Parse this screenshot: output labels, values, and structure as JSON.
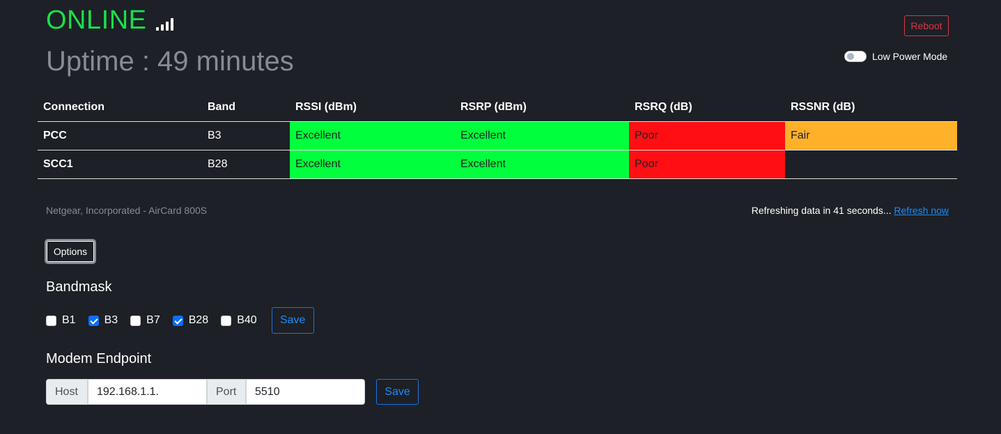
{
  "status": {
    "text": "ONLINE",
    "signal_bars": 4,
    "color": "#19e04a"
  },
  "uptime": "Uptime : 49 minutes",
  "header": {
    "reboot_label": "Reboot",
    "low_power_label": "Low Power Mode",
    "low_power_on": false
  },
  "table": {
    "headers": [
      "Connection",
      "Band",
      "RSSI (dBm)",
      "RSRP (dBm)",
      "RSRQ (dB)",
      "RSSNR (dB)"
    ],
    "rows": [
      {
        "connection": "PCC",
        "band": "B3",
        "rssi": "Excellent",
        "rsrp": "Excellent",
        "rsrq": "Poor",
        "rssnr": "Fair"
      },
      {
        "connection": "SCC1",
        "band": "B28",
        "rssi": "Excellent",
        "rsrp": "Excellent",
        "rsrq": "Poor",
        "rssnr": ""
      }
    ],
    "colors": {
      "excellent": "#00ff3c",
      "poor": "#ff0f14",
      "fair": "#ffb12a"
    }
  },
  "footer": {
    "device": "Netgear, Incorporated - AirCard 800S",
    "refresh_text": "Refreshing data in 41 seconds...",
    "refresh_link": "Refresh now"
  },
  "options_label": "Options",
  "bandmask": {
    "title": "Bandmask",
    "bands": [
      {
        "label": "B1",
        "checked": false
      },
      {
        "label": "B3",
        "checked": true
      },
      {
        "label": "B7",
        "checked": false
      },
      {
        "label": "B28",
        "checked": true
      },
      {
        "label": "B40",
        "checked": false
      }
    ],
    "save_label": "Save"
  },
  "endpoint": {
    "title": "Modem Endpoint",
    "host_label": "Host",
    "host_value": "192.168.1.1.",
    "port_label": "Port",
    "port_value": "5510",
    "save_label": "Save"
  }
}
